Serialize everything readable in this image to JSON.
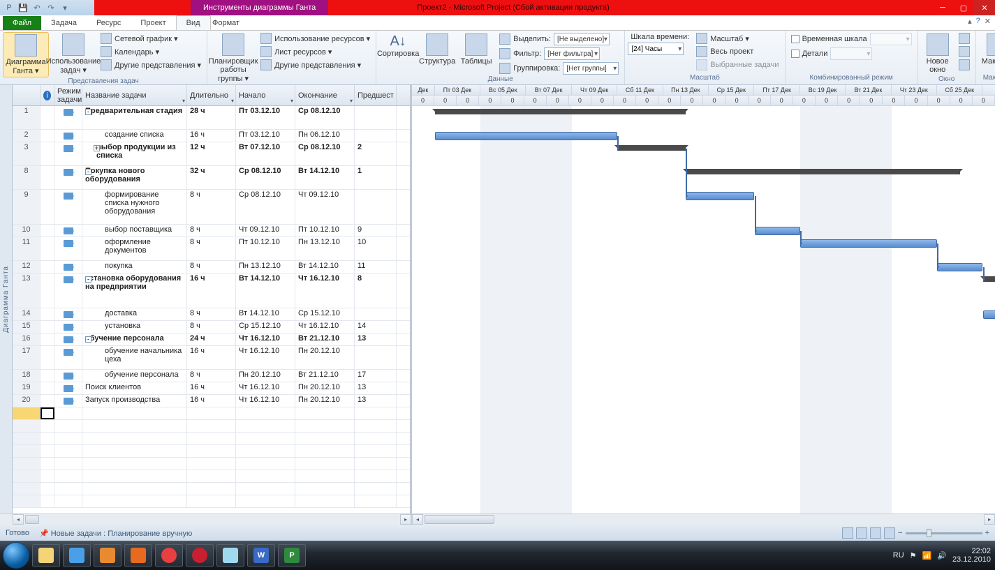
{
  "title": "Проект2 - Microsoft Project (Сбой активации продукта)",
  "toolTab": "Инструменты диаграммы Ганта",
  "tabs": {
    "file": "Файл",
    "task": "Задача",
    "resource": "Ресурс",
    "project": "Проект",
    "view": "Вид",
    "format": "Формат"
  },
  "ribbon": {
    "g1": {
      "gantt": "Диаграмма Ганта ▾",
      "usage": "Использование задач ▾",
      "net": "Сетевой график ▾",
      "cal": "Календарь ▾",
      "other": "Другие представления ▾",
      "label": "Представления задач"
    },
    "g2": {
      "team": "Планировщик работы группы ▾",
      "res1": "Использование ресурсов ▾",
      "res2": "Лист ресурсов ▾",
      "other": "Другие представления ▾",
      "label": "Представления ресурсов"
    },
    "g3": {
      "sort": "Сортировка",
      "struct": "Структура",
      "tables": "Таблицы",
      "hl": "Выделить:",
      "hlv": "[Не выделено]",
      "fl": "Фильтр:",
      "flv": "[Нет фильтра]",
      "gr": "Группировка:",
      "grv": "[Нет группы]",
      "label": "Данные"
    },
    "g4": {
      "ts": "Шкала времени:",
      "tsv": "[24] Часы",
      "zoom": "Масштаб ▾",
      "whole": "Весь проект",
      "sel": "Выбранные задачи",
      "label": "Масштаб"
    },
    "g5": {
      "tl": "Временная шкала",
      "det": "Детали",
      "label": "Комбинированный режим"
    },
    "g6": {
      "win": "Новое окно",
      "label": "Окно"
    },
    "g7": {
      "mac": "Макросы",
      "label": "Макросы"
    }
  },
  "cols": {
    "mode": "Режим задачи",
    "name": "Название задачи",
    "dur": "Длительно",
    "start": "Начало",
    "end": "Окончание",
    "pred": "Предшест"
  },
  "timeline": {
    "days": [
      "Дек",
      "Пт 03 Дек",
      "Вс 05 Дек",
      "Вт 07 Дек",
      "Чт 09 Дек",
      "Сб 11 Дек",
      "Пн 13 Дек",
      "Ср 15 Дек",
      "Пт 17 Дек",
      "Вс 19 Дек",
      "Вт 21 Дек",
      "Чт 23 Дек",
      "Сб 25 Дек"
    ],
    "hour": "0"
  },
  "tasks": [
    {
      "n": "1",
      "name": "Предварительная стадия",
      "dur": "28 ч",
      "s": "Пт 03.12.10",
      "e": "Ср 08.12.10",
      "p": "",
      "b": 1,
      "ind": 0,
      "out": "-"
    },
    {
      "n": "2",
      "name": "создание списка",
      "dur": "16 ч",
      "s": "Пт 03.12.10",
      "e": "Пн 06.12.10",
      "p": "",
      "b": 0,
      "ind": 2
    },
    {
      "n": "3",
      "name": "выбор продукции из списка",
      "dur": "12 ч",
      "s": "Вт 07.12.10",
      "e": "Ср 08.12.10",
      "p": "2",
      "b": 1,
      "ind": 1,
      "out": "+"
    },
    {
      "n": "8",
      "name": "Покупка нового оборудования",
      "dur": "32 ч",
      "s": "Ср 08.12.10",
      "e": "Вт 14.12.10",
      "p": "1",
      "b": 1,
      "ind": 0,
      "out": "-"
    },
    {
      "n": "9",
      "name": "формирование списка нужного оборудования",
      "dur": "8 ч",
      "s": "Ср 08.12.10",
      "e": "Чт 09.12.10",
      "p": "",
      "b": 0,
      "ind": 2
    },
    {
      "n": "10",
      "name": "выбор поставщика",
      "dur": "8 ч",
      "s": "Чт 09.12.10",
      "e": "Пт 10.12.10",
      "p": "9",
      "b": 0,
      "ind": 2
    },
    {
      "n": "11",
      "name": "оформление документов",
      "dur": "8 ч",
      "s": "Пт 10.12.10",
      "e": "Пн 13.12.10",
      "p": "10",
      "b": 0,
      "ind": 2
    },
    {
      "n": "12",
      "name": "покупка",
      "dur": "8 ч",
      "s": "Пн 13.12.10",
      "e": "Вт 14.12.10",
      "p": "11",
      "b": 0,
      "ind": 2
    },
    {
      "n": "13",
      "name": "установка оборудования на предприятии",
      "dur": "16 ч",
      "s": "Вт 14.12.10",
      "e": "Чт 16.12.10",
      "p": "8",
      "b": 1,
      "ind": 0,
      "out": "-"
    },
    {
      "n": "14",
      "name": "доставка",
      "dur": "8 ч",
      "s": "Вт 14.12.10",
      "e": "Ср 15.12.10",
      "p": "",
      "b": 0,
      "ind": 2
    },
    {
      "n": "15",
      "name": "установка",
      "dur": "8 ч",
      "s": "Ср 15.12.10",
      "e": "Чт 16.12.10",
      "p": "14",
      "b": 0,
      "ind": 2
    },
    {
      "n": "16",
      "name": "обучение персонала",
      "dur": "24 ч",
      "s": "Чт 16.12.10",
      "e": "Вт 21.12.10",
      "p": "13",
      "b": 1,
      "ind": 0,
      "out": "-"
    },
    {
      "n": "17",
      "name": "обучение начальника цеха",
      "dur": "16 ч",
      "s": "Чт 16.12.10",
      "e": "Пн 20.12.10",
      "p": "",
      "b": 0,
      "ind": 2
    },
    {
      "n": "18",
      "name": "обучение персонала",
      "dur": "8 ч",
      "s": "Пн 20.12.10",
      "e": "Вт 21.12.10",
      "p": "17",
      "b": 0,
      "ind": 2
    },
    {
      "n": "19",
      "name": "Поиск клиентов",
      "dur": "16 ч",
      "s": "Чт 16.12.10",
      "e": "Пн 20.12.10",
      "p": "13",
      "b": 0,
      "ind": 0
    },
    {
      "n": "20",
      "name": "Запуск производства",
      "dur": "16 ч",
      "s": "Чт 16.12.10",
      "e": "Пн 20.12.10",
      "p": "13",
      "b": 0,
      "ind": 0
    }
  ],
  "sidebar": "Диаграмма Ганта",
  "status": {
    "ready": "Готово",
    "mode": "Новые задачи : Планирование вручную"
  },
  "tray": {
    "lang": "RU",
    "time": "22:02",
    "date": "23.12.2010"
  }
}
